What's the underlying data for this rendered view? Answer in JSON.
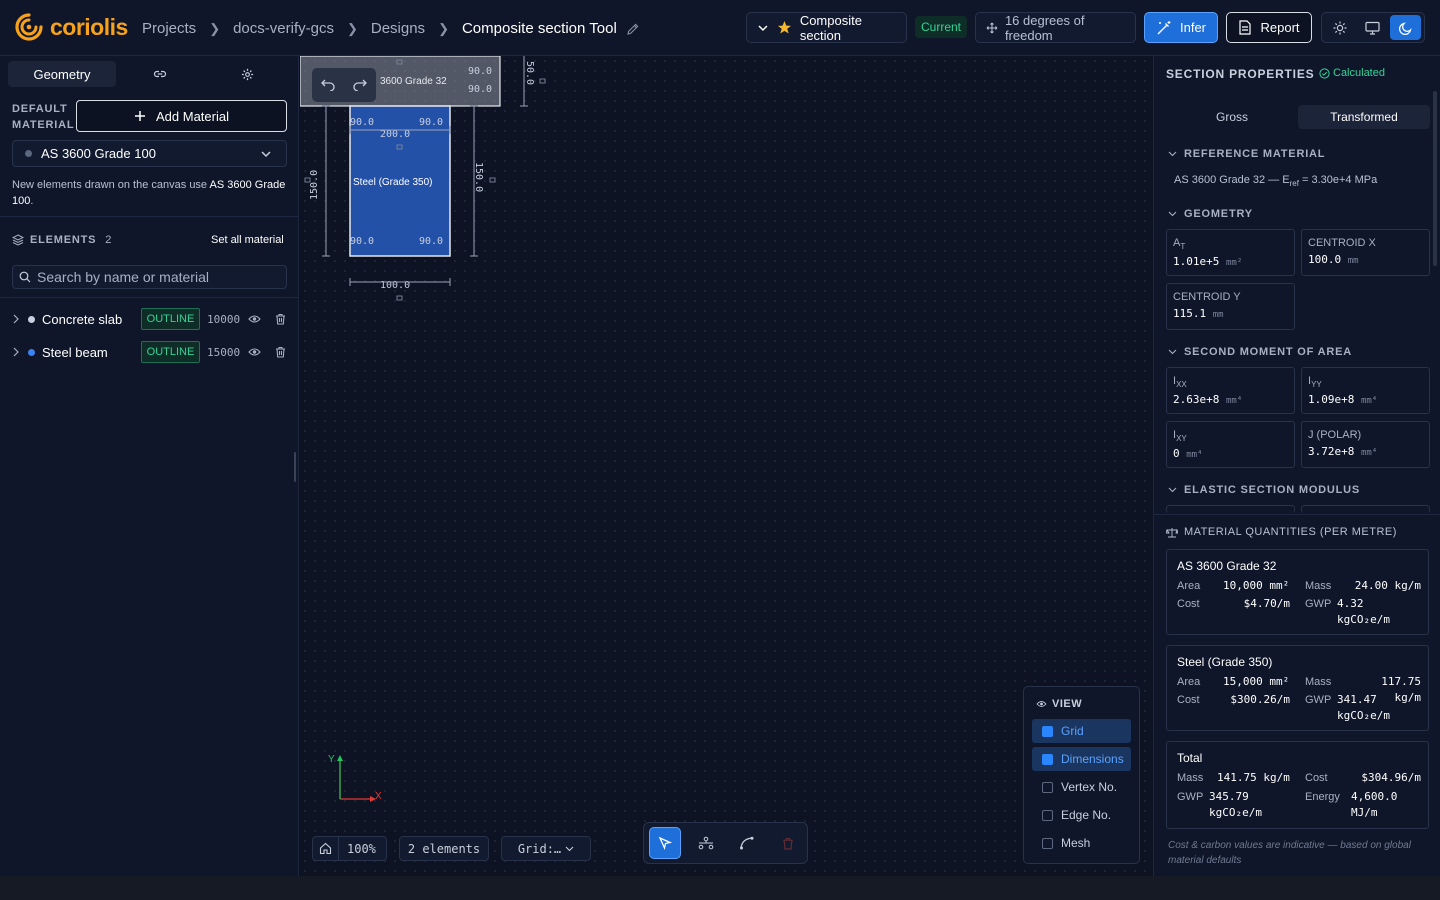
{
  "brand": {
    "name": "coriolis",
    "color": "#f7a21b"
  },
  "breadcrumb": [
    "Projects",
    "docs-verify-gcs",
    "Designs",
    "Composite section Tool"
  ],
  "topbar": {
    "section_select": "Composite section",
    "status_badge": "Current",
    "dof_label": "16 degrees of freedom",
    "infer_label": "Infer",
    "report_label": "Report",
    "theme_options": [
      "sun-icon",
      "monitor-icon",
      "moon-icon"
    ],
    "theme_selected": "dark"
  },
  "left": {
    "tabs": [
      "Geometry",
      "link-icon",
      "gear-icon"
    ],
    "default_material_label": [
      "DEFAULT",
      "MATERIAL"
    ],
    "add_material": "Add Material",
    "material_value": "AS 3600 Grade 100",
    "note_prefix": "New elements drawn on the canvas use ",
    "note_material": "AS 3600 Grade 100",
    "note_suffix": ".",
    "elements_label": "ELEMENTS",
    "elements_count": "2",
    "set_all": "Set all material",
    "search_placeholder": "Search by name or material",
    "elements": [
      {
        "name": "Concrete slab",
        "badge": "OUTLINE",
        "area": "10000",
        "color": "#c8cfdd"
      },
      {
        "name": "Steel beam",
        "badge": "OUTLINE",
        "area": "15000",
        "color": "#3b82f6"
      }
    ]
  },
  "canvas": {
    "slab_label": "3600 Grade 32",
    "beam_label": "Steel (Grade 350)",
    "dims": {
      "slab_width": "200.0",
      "slab_height": "50.0",
      "beam_height_left": "150.0",
      "beam_height_right": "150.0",
      "beam_width": "100.0",
      "corner": "90.0"
    },
    "axes": {
      "x": "X",
      "y": "Y"
    },
    "zoom": "100%",
    "element_count": "2 elements",
    "grid_select": "Grid:…",
    "view": {
      "title": "VIEW",
      "options": [
        {
          "label": "Grid",
          "on": true
        },
        {
          "label": "Dimensions",
          "on": true
        },
        {
          "label": "Vertex No.",
          "on": false
        },
        {
          "label": "Edge No.",
          "on": false
        },
        {
          "label": "Mesh",
          "on": false
        }
      ]
    }
  },
  "right": {
    "title": "SECTION PROPERTIES",
    "status": "Calculated",
    "tabs": [
      "Gross",
      "Transformed"
    ],
    "active_tab": "Transformed",
    "ref_head": "REFERENCE MATERIAL",
    "ref_text_pre": "AS 3600 Grade 32 — E",
    "ref_sub": "ref",
    "ref_text_post": " = 3.30e+4 MPa",
    "geom_head": "GEOMETRY",
    "geometry": [
      {
        "label": "A",
        "sub": "T",
        "value": "1.01e+5",
        "unit": "mm²"
      },
      {
        "label": "CENTROID X",
        "sub": "",
        "value": "100.0",
        "unit": "mm"
      },
      {
        "label": "CENTROID Y",
        "sub": "",
        "value": "115.1",
        "unit": "mm"
      }
    ],
    "moment_head": "SECOND MOMENT OF AREA",
    "moments": [
      {
        "label": "I",
        "sub": "XX",
        "value": "2.63e+8",
        "unit": "mm⁴"
      },
      {
        "label": "I",
        "sub": "YY",
        "value": "1.09e+8",
        "unit": "mm⁴"
      },
      {
        "label": "I",
        "sub": "XY",
        "value": "0",
        "unit": "mm⁴"
      },
      {
        "label": "J (POLAR)",
        "sub": "",
        "value": "3.72e+8",
        "unit": "mm⁴"
      }
    ],
    "modulus_head": "ELASTIC SECTION MODULUS",
    "qty_head": "MATERIAL QUANTITIES (PER METRE)",
    "quantities": [
      {
        "name": "AS 3600 Grade 32",
        "area": "10,000 mm²",
        "mass": "24.00 kg/m",
        "cost": "$4.70/m",
        "gwp": "4.32",
        "gwp_unit": "kgCO₂e/m"
      },
      {
        "name": "Steel (Grade 350)",
        "area": "15,000 mm²",
        "mass": "117.75 kg/m",
        "cost": "$300.26/m",
        "gwp": "341.47",
        "gwp_unit": "kgCO₂e/m"
      }
    ],
    "total": {
      "name": "Total",
      "mass": "141.75 kg/m",
      "cost": "$304.96/m",
      "gwp": "345.79",
      "gwp_unit": "kgCO₂e/m",
      "energy": "4,600.0",
      "energy_unit": "MJ/m"
    },
    "labels": {
      "area": "Area",
      "mass": "Mass",
      "cost": "Cost",
      "gwp": "GWP",
      "energy": "Energy"
    },
    "footnote": "Cost & carbon values are indicative — based on global material defaults"
  }
}
